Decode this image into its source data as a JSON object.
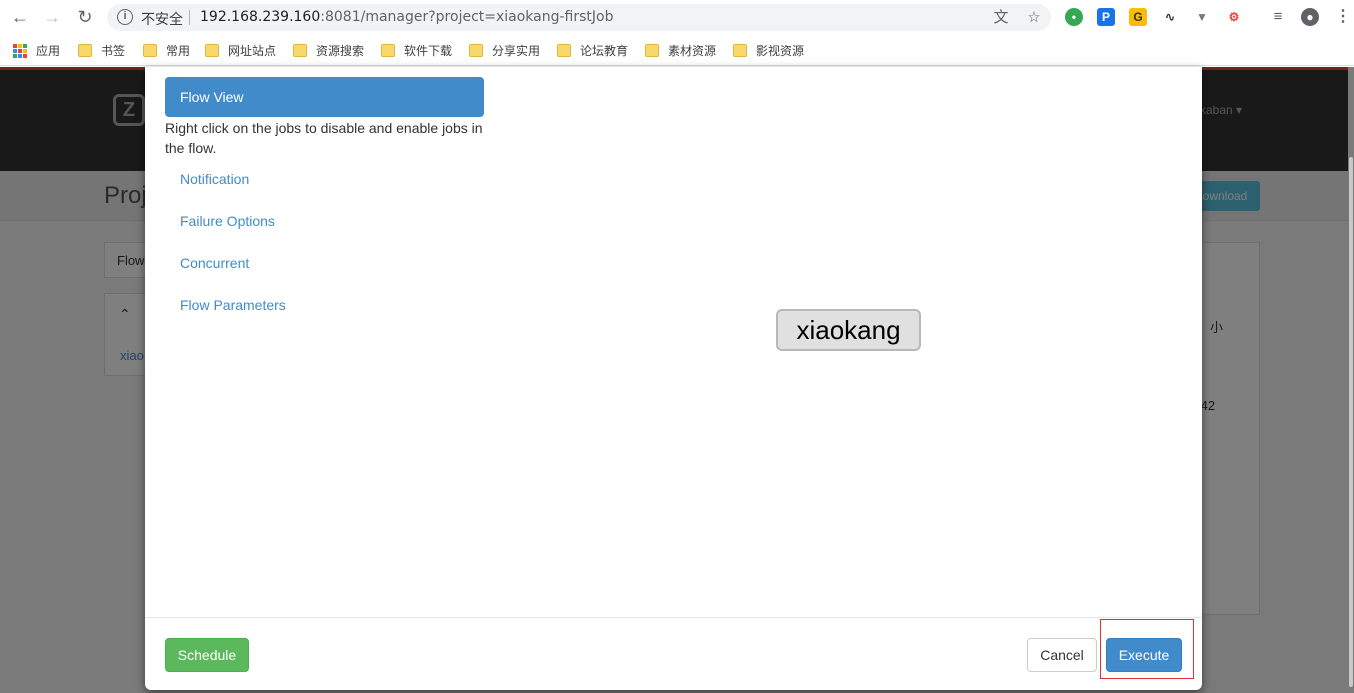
{
  "browser": {
    "insecure_label": "不安全",
    "url_host": "192.168.239.160",
    "url_rest": ":8081/manager?project=xiaokang-firstJob",
    "bookmarks": [
      {
        "label": "应用",
        "icon": "apps-grid-icon"
      },
      {
        "label": "书签",
        "icon": "folder-icon"
      },
      {
        "label": "常用",
        "icon": "folder-icon"
      },
      {
        "label": "网址站点",
        "icon": "folder-icon"
      },
      {
        "label": "资源搜索",
        "icon": "folder-icon"
      },
      {
        "label": "软件下载",
        "icon": "folder-icon"
      },
      {
        "label": "分享实用",
        "icon": "folder-icon"
      },
      {
        "label": "论坛教育",
        "icon": "folder-icon"
      },
      {
        "label": "素材资源",
        "icon": "folder-icon"
      },
      {
        "label": "影视资源",
        "icon": "folder-icon"
      }
    ]
  },
  "background_page": {
    "user_menu": "kaban",
    "title_fragment": "Proj",
    "download_label": "ownload",
    "tab_fragment": "Flow",
    "row_fragment": "xiao",
    "right_fragment_1": "：小",
    "right_fragment_2": ":42"
  },
  "modal": {
    "side_nav": {
      "active_label": "Flow View",
      "hint": "Right click on the jobs to disable and enable jobs in the flow.",
      "links": [
        "Notification",
        "Failure Options",
        "Concurrent",
        "Flow Parameters"
      ]
    },
    "graph": {
      "node_label": "xiaokang"
    },
    "footer": {
      "schedule_label": "Schedule",
      "cancel_label": "Cancel",
      "execute_label": "Execute"
    }
  },
  "colors": {
    "primary": "#428bca",
    "success": "#5cb85c",
    "header_bg": "#333333",
    "highlight": "#e03030"
  }
}
